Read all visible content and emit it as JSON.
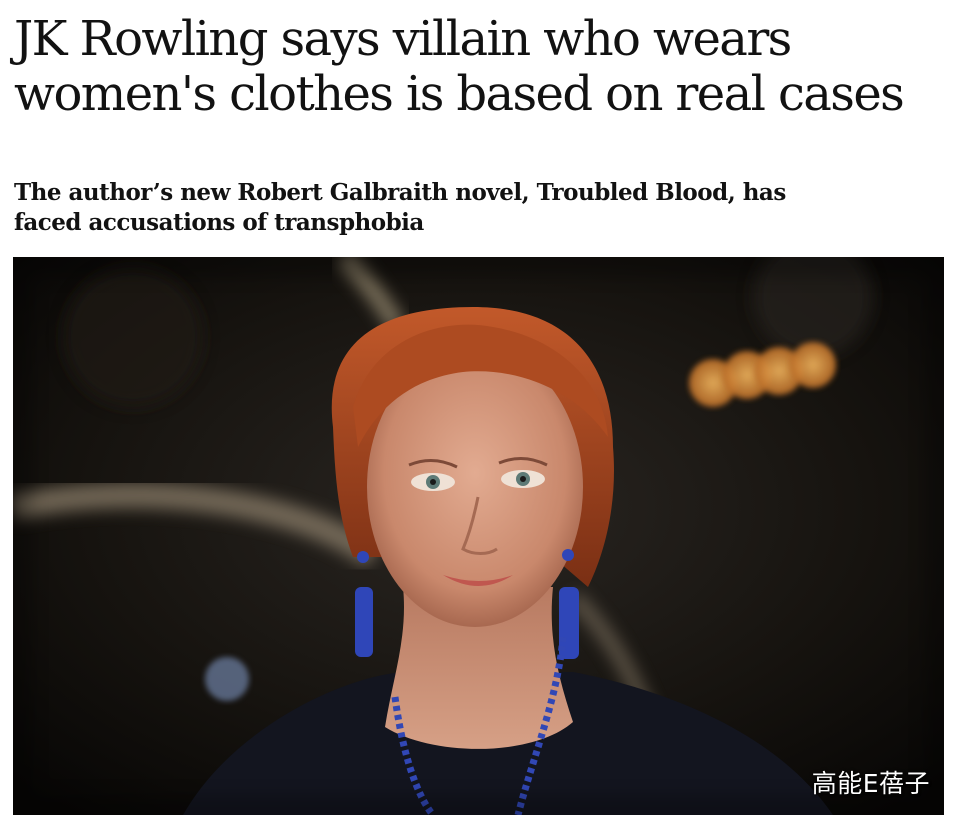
{
  "article": {
    "headline": "JK Rowling says villain who wears women's clothes is based on real cases",
    "standfirst": "The author’s new Robert Galbraith novel, Troubled Blood, has faced accusations of transphobia"
  },
  "photo": {
    "watermark": "高能E蓓子",
    "colors": {
      "background": "#0d0b0a",
      "hair": "#a2451f",
      "skin": "#d49a80",
      "dress": "#13151f",
      "jewelry": "#2f46b8",
      "bokeh": "#e7a04b"
    }
  }
}
